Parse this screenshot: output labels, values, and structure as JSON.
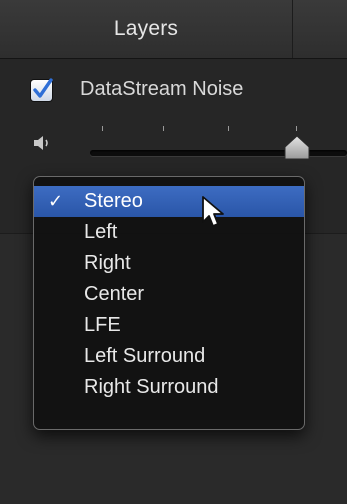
{
  "header": {
    "tab_label": "Layers"
  },
  "layer": {
    "name": "DataStream Noise",
    "checked": true
  },
  "volume": {
    "icon": "speaker-icon",
    "level": 0.8
  },
  "menu": {
    "items": [
      {
        "label": "Stereo",
        "selected": true,
        "mark": "✓"
      },
      {
        "label": "Left",
        "selected": false
      },
      {
        "label": "Right",
        "selected": false
      },
      {
        "label": "Center",
        "selected": false
      },
      {
        "label": "LFE",
        "selected": false
      },
      {
        "label": "Left Surround",
        "selected": false
      },
      {
        "label": "Right Surround",
        "selected": false
      }
    ]
  },
  "colors": {
    "selection": "#2f5db3",
    "checkbox_mark": "#2f6fd6",
    "background": "#262626"
  }
}
